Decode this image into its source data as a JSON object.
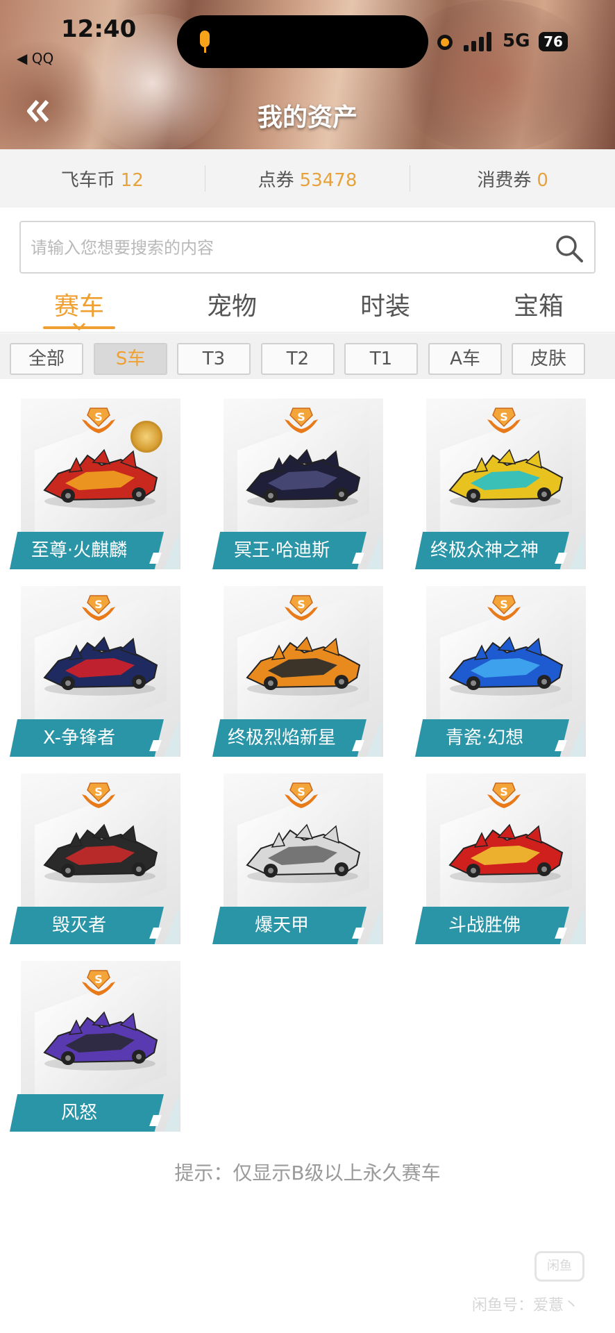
{
  "status_bar": {
    "time": "12:40",
    "back_app": "◀ QQ",
    "network": "5G",
    "battery": "76"
  },
  "header": {
    "title": "我的资产",
    "back_icon": "double-chevron-left-icon"
  },
  "currencies": [
    {
      "label": "飞车币",
      "value": "12"
    },
    {
      "label": "点券",
      "value": "53478"
    },
    {
      "label": "消费券",
      "value": "0"
    }
  ],
  "search": {
    "placeholder": "请输入您想要搜索的内容",
    "icon": "search-icon"
  },
  "tabs": [
    "赛车",
    "宠物",
    "时装",
    "宝箱"
  ],
  "active_tab": "赛车",
  "filters": [
    "全部",
    "S车",
    "T3",
    "T2",
    "T1",
    "A车",
    "皮肤"
  ],
  "selected_filter": "S车",
  "cars": [
    {
      "name": "至尊·火麒麟",
      "badge": "S",
      "has_medal": true,
      "colors": [
        "#c8281e",
        "#f0a020"
      ]
    },
    {
      "name": "冥王·哈迪斯",
      "badge": "S",
      "has_medal": false,
      "colors": [
        "#1f1f3a",
        "#4a4a7a"
      ]
    },
    {
      "name": "终极众神之神",
      "badge": "S",
      "has_medal": false,
      "colors": [
        "#e8c21e",
        "#28c0c8"
      ]
    },
    {
      "name": "X-争锋者",
      "badge": "S",
      "has_medal": false,
      "colors": [
        "#1e2a60",
        "#d0202a"
      ]
    },
    {
      "name": "终极烈焰新星",
      "badge": "S",
      "has_medal": false,
      "colors": [
        "#e88a1e",
        "#2a2a2a"
      ]
    },
    {
      "name": "青瓷·幻想",
      "badge": "S",
      "has_medal": false,
      "colors": [
        "#1e5ad0",
        "#40a8f0"
      ]
    },
    {
      "name": "毁灭者",
      "badge": "S",
      "has_medal": false,
      "colors": [
        "#2a2a2a",
        "#c82a2a"
      ]
    },
    {
      "name": "爆天甲",
      "badge": "S",
      "has_medal": false,
      "colors": [
        "#d8d8d8",
        "#6a6a6a"
      ]
    },
    {
      "name": "斗战胜佛",
      "badge": "S",
      "has_medal": false,
      "colors": [
        "#d0201e",
        "#f0c030"
      ]
    },
    {
      "name": "风怒",
      "badge": "S",
      "has_medal": false,
      "colors": [
        "#5a3ab0",
        "#2a2a3a"
      ]
    }
  ],
  "hint": "提示：仅显示B级以上永久赛车",
  "watermark": {
    "logo": "闲鱼",
    "text": "闲鱼号：爱薏丶"
  },
  "accent_color": "#f0a030",
  "label_color": "#2b95a8"
}
